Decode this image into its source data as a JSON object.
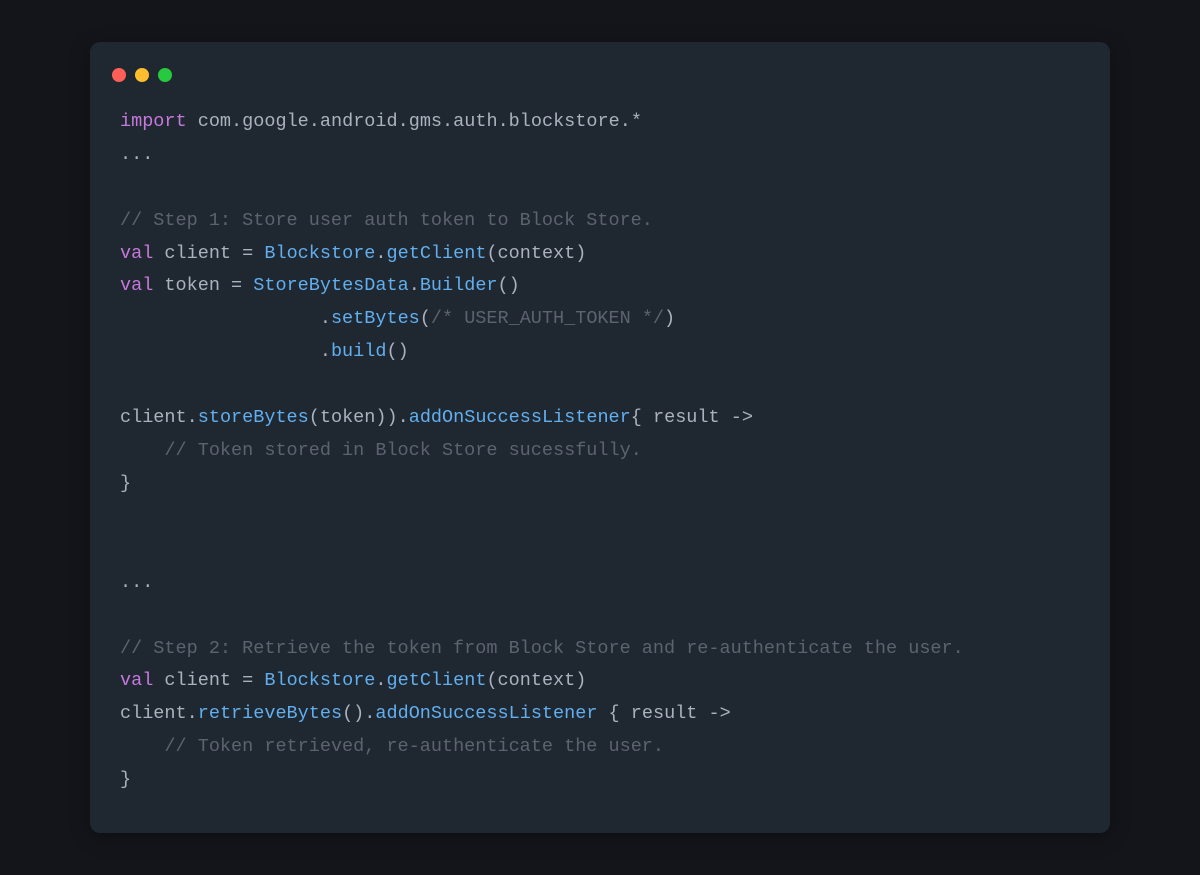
{
  "window": {
    "traffic_lights": {
      "red": "close-window",
      "yellow": "minimize-window",
      "green": "zoom-window"
    }
  },
  "code": {
    "lines": [
      {
        "type": "l01",
        "k_import": "import",
        "pkg": " com",
        "d1": ".",
        "p1": "google",
        "d2": ".",
        "p2": "android",
        "d3": ".",
        "p3": "gms",
        "d4": ".",
        "p4": "auth",
        "d5": ".",
        "p5": "blockstore",
        "d6": ".",
        "star": "*"
      },
      {
        "type": "dots",
        "text": "..."
      },
      {
        "type": "blank",
        "text": ""
      },
      {
        "type": "comment",
        "text": "// Step 1: Store user auth token to Block Store."
      },
      {
        "type": "l04",
        "k_val": "val",
        "sp1": " ",
        "name": "client",
        "sp2": " ",
        "eq": "=",
        "sp3": " ",
        "cls": "Blockstore",
        "dot": ".",
        "fn": "getClient",
        "lp": "(",
        "arg": "context",
        "rp": ")"
      },
      {
        "type": "l05",
        "k_val": "val",
        "sp1": " ",
        "name": "token",
        "sp2": " ",
        "eq": "=",
        "sp3": " ",
        "cls": "StoreBytesData",
        "dot": ".",
        "fn": "Builder",
        "lp": "(",
        "rp": ")"
      },
      {
        "type": "l06",
        "indent": "                  ",
        "dot": ".",
        "fn": "setBytes",
        "lp": "(",
        "cmt": "/* USER_AUTH_TOKEN */",
        "rp": ")"
      },
      {
        "type": "l07",
        "indent": "                  ",
        "dot": ".",
        "fn": "build",
        "lp": "(",
        "rp": ")"
      },
      {
        "type": "blank",
        "text": ""
      },
      {
        "type": "l08",
        "obj": "client",
        "dot1": ".",
        "fn1": "storeBytes",
        "lp1": "(",
        "arg1": "token",
        "rp1": ")",
        "rp2": ")",
        "dot2": ".",
        "fn2": "addOnSuccessListener",
        "lb": "{",
        "sp": " ",
        "param": "result",
        "sp2": " ",
        "arrow": "->"
      },
      {
        "type": "commentIndent",
        "indent": "    ",
        "text": "// Token stored in Block Store sucessfully."
      },
      {
        "type": "closebrace",
        "text": "}"
      },
      {
        "type": "blank",
        "text": ""
      },
      {
        "type": "blank",
        "text": ""
      },
      {
        "type": "dots",
        "text": "..."
      },
      {
        "type": "blank",
        "text": ""
      },
      {
        "type": "comment",
        "text": "// Step 2: Retrieve the token from Block Store and re-authenticate the user."
      },
      {
        "type": "l04b",
        "k_val": "val",
        "sp1": " ",
        "name": "client",
        "sp2": " ",
        "eq": "=",
        "sp3": " ",
        "cls": "Blockstore",
        "dot": ".",
        "fn": "getClient",
        "lp": "(",
        "arg": "context",
        "rp": ")"
      },
      {
        "type": "l17",
        "obj": "client",
        "dot1": ".",
        "fn1": "retrieveBytes",
        "lp1": "(",
        "rp1": ")",
        "dot2": ".",
        "fn2": "addOnSuccessListener",
        "sp0": " ",
        "lb": "{",
        "sp": " ",
        "param": "result",
        "sp2": " ",
        "arrow": "->"
      },
      {
        "type": "commentIndent",
        "indent": "    ",
        "text": "// Token retrieved, re-authenticate the user."
      },
      {
        "type": "closebrace",
        "text": "}"
      }
    ]
  }
}
